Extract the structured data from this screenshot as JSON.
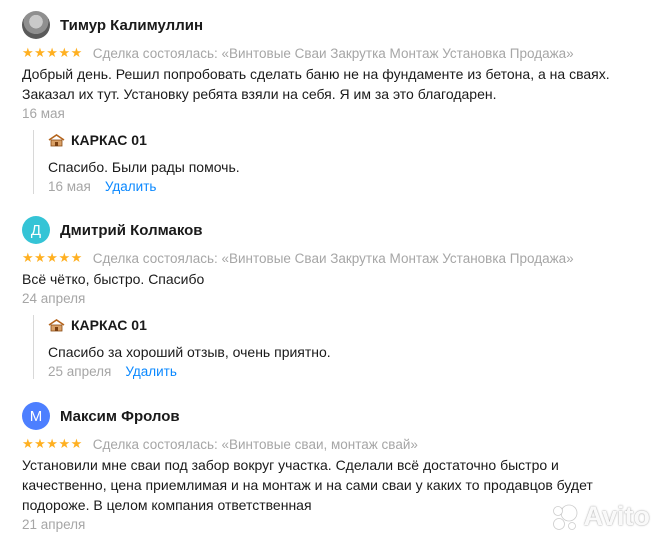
{
  "reviews": [
    {
      "author": "Тимур Калимуллин",
      "avatar_letter": "",
      "avatar_color": "#8f8f8f",
      "stars": "★★★★★",
      "deal": "Сделка состоялась: «Винтовые Сваи Закрутка Монтаж Установка Продажа»",
      "text": "Добрый день. Решил попробовать сделать баню не на фундаменте из бетона, а на сваях. Заказал их тут. Установку ребята взяли на себя. Я им за это благодарен.",
      "date": "16 мая",
      "reply": {
        "name": "КАРКАС 01",
        "text": "Спасибо. Были рады помочь.",
        "date": "16 мая",
        "delete_label": "Удалить"
      }
    },
    {
      "author": "Дмитрий Колмаков",
      "avatar_letter": "Д",
      "avatar_color": "#35c4d6",
      "stars": "★★★★★",
      "deal": "Сделка состоялась: «Винтовые Сваи Закрутка Монтаж Установка Продажа»",
      "text": "Всё чётко, быстро. Спасибо",
      "date": "24 апреля",
      "reply": {
        "name": "КАРКАС 01",
        "text": "Спасибо за хороший отзыв, очень приятно.",
        "date": "25 апреля",
        "delete_label": "Удалить"
      }
    },
    {
      "author": "Максим Фролов",
      "avatar_letter": "М",
      "avatar_color": "#4d7fff",
      "stars": "★★★★★",
      "deal": "Сделка состоялась: «Винтовые сваи, монтаж свай»",
      "text": "Установили мне сваи под забор вокруг участка. Сделали всё достаточно быстро и качественно, цена приемлимая и на монтаж и на сами сваи у каких то продавцов будет подороже. В целом компания ответственная",
      "date": "21 апреля"
    }
  ],
  "star_color": "#ffb021",
  "link_color": "#0a88ff",
  "watermark": "Avito"
}
